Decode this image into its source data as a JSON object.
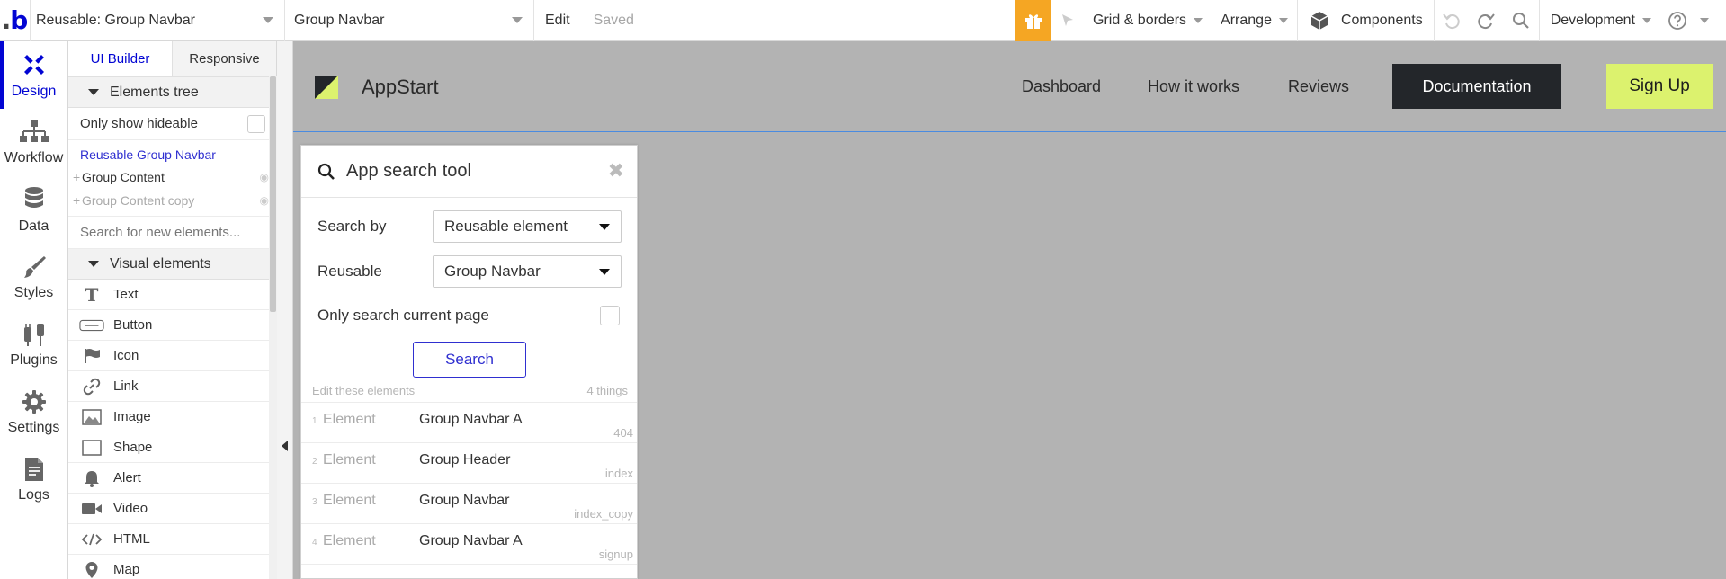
{
  "topbar": {
    "page_select": "Reusable: Group Navbar",
    "element_select": "Group Navbar",
    "edit_label": "Edit",
    "saved_label": "Saved",
    "grid_label": "Grid & borders",
    "arrange_label": "Arrange",
    "components_label": "Components",
    "env_label": "Development",
    "accent_color": "#f5a623"
  },
  "iconbar": {
    "items": [
      {
        "label": "Design",
        "icon": "design-icon"
      },
      {
        "label": "Workflow",
        "icon": "workflow-icon"
      },
      {
        "label": "Data",
        "icon": "database-icon"
      },
      {
        "label": "Styles",
        "icon": "brush-icon"
      },
      {
        "label": "Plugins",
        "icon": "plug-icon"
      },
      {
        "label": "Settings",
        "icon": "gear-icon"
      },
      {
        "label": "Logs",
        "icon": "document-icon"
      }
    ]
  },
  "panel": {
    "tabs": [
      "UI Builder",
      "Responsive"
    ],
    "elements_tree_label": "Elements tree",
    "only_show_hideable": "Only show hideable",
    "tree_root": "Reusable Group Navbar",
    "tree_nodes": [
      "Group Content",
      "Group Content copy"
    ],
    "search_placeholder": "Search for new elements...",
    "visual_elements_label": "Visual elements",
    "visual_elements": [
      {
        "label": "Text",
        "icon": "text-icon"
      },
      {
        "label": "Button",
        "icon": "button-icon"
      },
      {
        "label": "Icon",
        "icon": "flag-icon"
      },
      {
        "label": "Link",
        "icon": "link-icon"
      },
      {
        "label": "Image",
        "icon": "image-icon"
      },
      {
        "label": "Shape",
        "icon": "shape-icon"
      },
      {
        "label": "Alert",
        "icon": "bell-icon"
      },
      {
        "label": "Video",
        "icon": "video-icon"
      },
      {
        "label": "HTML",
        "icon": "code-icon"
      },
      {
        "label": "Map",
        "icon": "map-pin-icon"
      }
    ]
  },
  "canvas": {
    "background": "#b3b3b3",
    "brand": "AppStart",
    "nav_links": [
      "Dashboard",
      "How it works",
      "Reviews"
    ],
    "doc_button": "Documentation",
    "signup_button": "Sign Up",
    "signup_color": "#dcf26e"
  },
  "search_tool": {
    "title": "App search tool",
    "search_by_label": "Search by",
    "search_by_value": "Reusable element",
    "reusable_label": "Reusable",
    "reusable_value": "Group Navbar",
    "only_current_page": "Only search current page",
    "search_button": "Search",
    "results_header": "Edit these elements",
    "results_count": "4 things",
    "results": [
      {
        "num": "1",
        "type": "Element",
        "name": "Group Navbar A",
        "page": "404"
      },
      {
        "num": "2",
        "type": "Element",
        "name": "Group Header",
        "page": "index"
      },
      {
        "num": "3",
        "type": "Element",
        "name": "Group Navbar",
        "page": "index_copy"
      },
      {
        "num": "4",
        "type": "Element",
        "name": "Group Navbar A",
        "page": "signup"
      }
    ]
  }
}
